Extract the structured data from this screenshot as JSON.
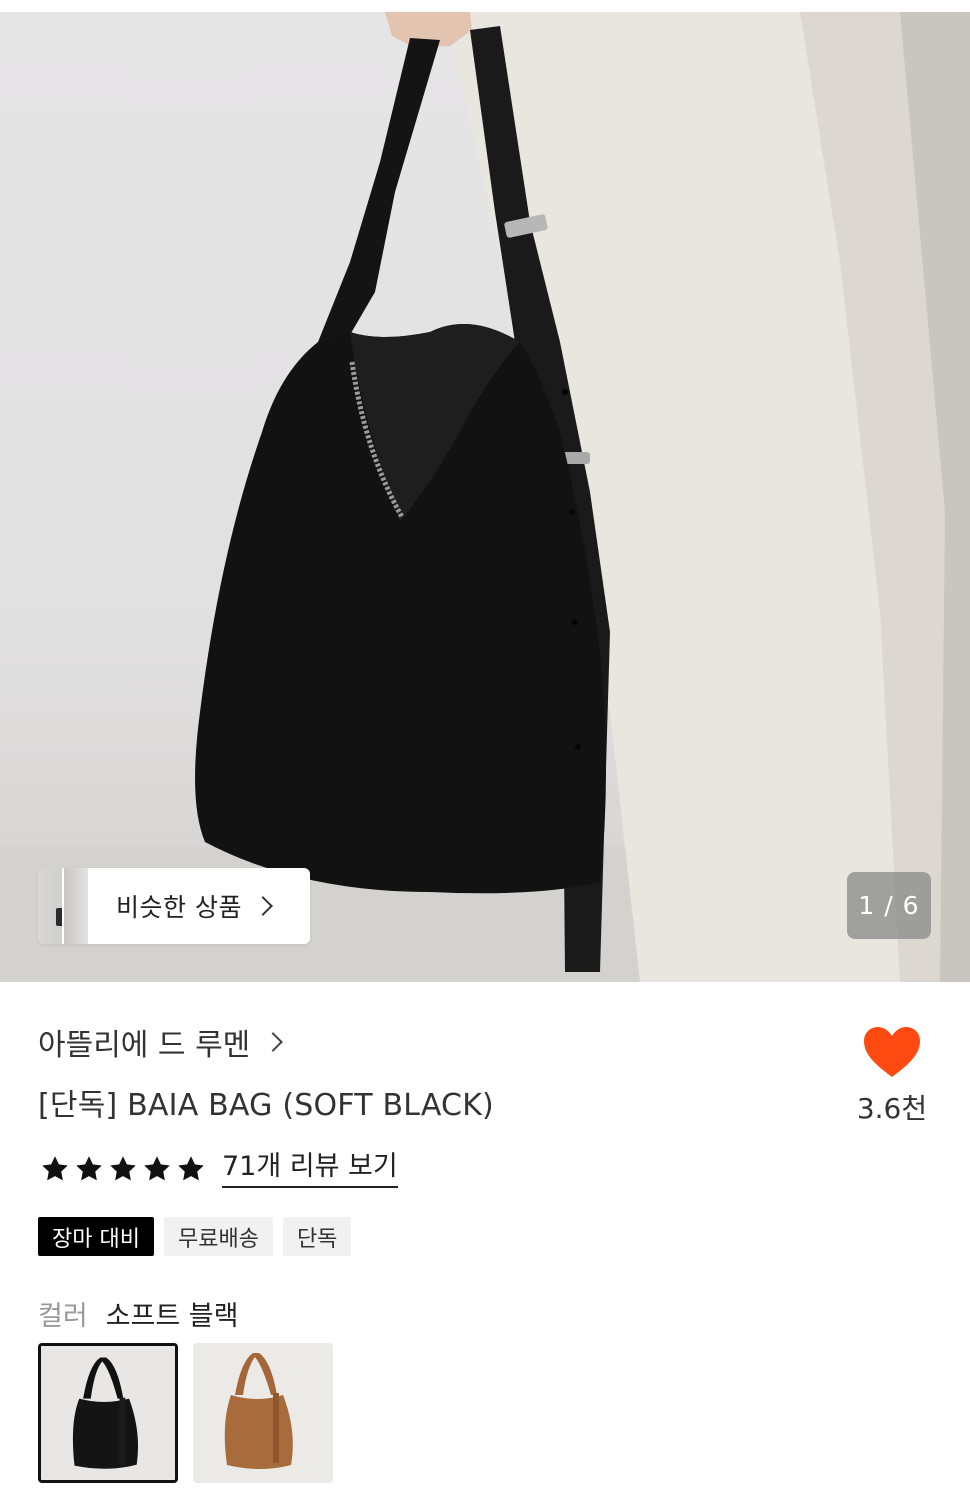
{
  "hero": {
    "similar_label": "비슷한 상품",
    "pager": "1 / 6"
  },
  "product": {
    "brand": "아뜰리에 드 루멘",
    "title": "[단독] BAIA BAG (SOFT BLACK)",
    "rating_stars": 5,
    "reviews_link": "71개 리뷰 보기",
    "like_count": "3.6천",
    "tags": [
      "장마 대비",
      "무료배송",
      "단독"
    ],
    "color_key": "컬러",
    "color_value": "소프트 블랙",
    "swatches": [
      "soft-black",
      "brown"
    ]
  },
  "colors": {
    "heart": "#ff4b12",
    "star": "#111111",
    "tag_dark_bg": "#000000"
  }
}
